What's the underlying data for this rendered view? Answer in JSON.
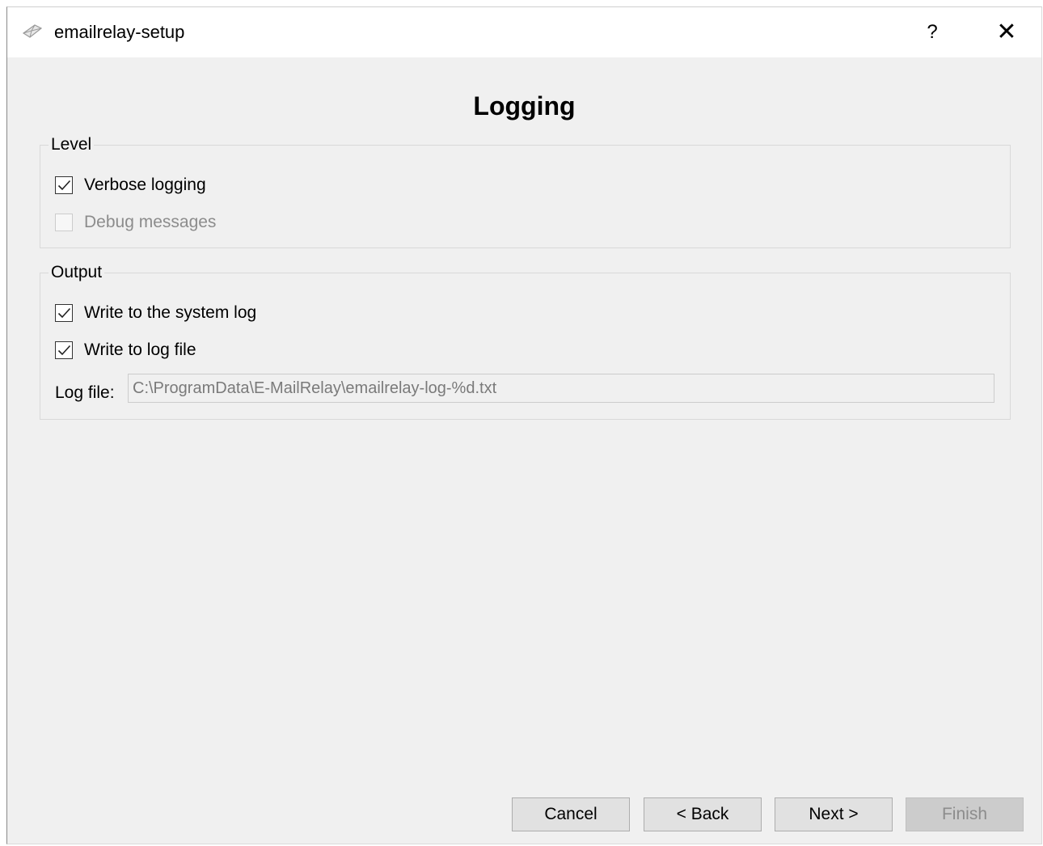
{
  "window": {
    "title": "emailrelay-setup",
    "help_label": "?",
    "close_label": "✕"
  },
  "page": {
    "title": "Logging"
  },
  "level_group": {
    "label": "Level",
    "verbose": {
      "label": "Verbose logging",
      "checked": true,
      "enabled": true
    },
    "debug": {
      "label": "Debug messages",
      "checked": false,
      "enabled": false
    }
  },
  "output_group": {
    "label": "Output",
    "system_log": {
      "label": "Write to the system log",
      "checked": true,
      "enabled": true
    },
    "log_file_check": {
      "label": "Write to log file",
      "checked": true,
      "enabled": true
    },
    "log_file_field": {
      "label": "Log file:",
      "value": "C:\\ProgramData\\E-MailRelay\\emailrelay-log-%d.txt"
    }
  },
  "buttons": {
    "cancel": "Cancel",
    "back": "< Back",
    "next": "Next >",
    "finish": "Finish"
  }
}
